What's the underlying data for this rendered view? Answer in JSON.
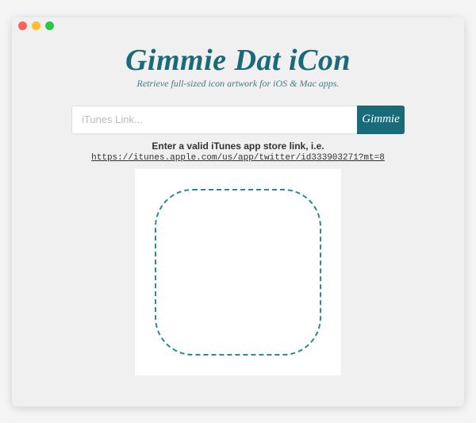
{
  "header": {
    "title": "Gimmie Dat iCon",
    "subtitle": "Retrieve full-sized icon artwork for iOS & Mac apps."
  },
  "search": {
    "placeholder": "iTunes Link...",
    "button_label": "Gimmie"
  },
  "hint": {
    "text": "Enter a valid iTunes app store link, i.e.",
    "example_link": "https://itunes.apple.com/us/app/twitter/id333903271?mt=8"
  },
  "colors": {
    "accent": "#1a6b7a"
  }
}
